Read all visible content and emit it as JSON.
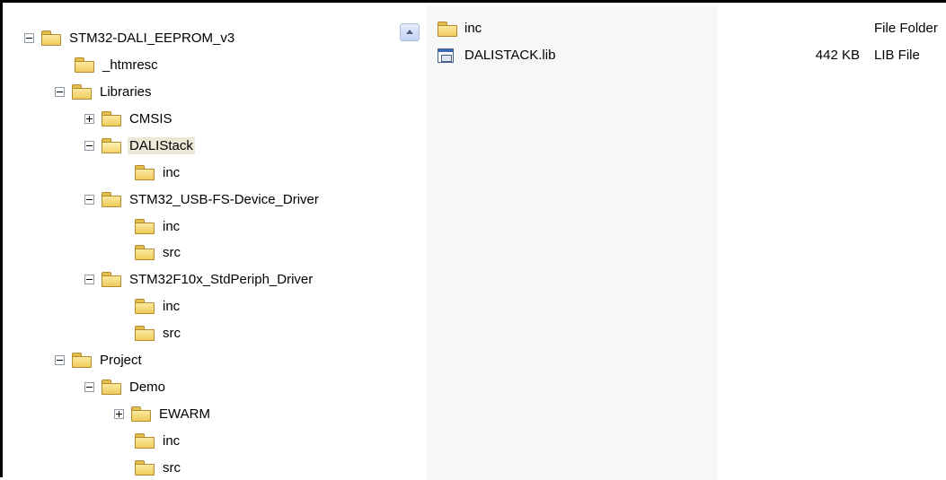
{
  "tree": {
    "nodes": [
      {
        "label": "STM32-DALI_EEPROM_v3",
        "toggle": "minus"
      },
      {
        "label": "_htmresc",
        "toggle": "none"
      },
      {
        "label": "Libraries",
        "toggle": "minus"
      },
      {
        "label": "CMSIS",
        "toggle": "plus"
      },
      {
        "label": "DALIStack",
        "toggle": "minus",
        "selected": true
      },
      {
        "label": "inc",
        "toggle": "none"
      },
      {
        "label": "STM32_USB-FS-Device_Driver",
        "toggle": "minus"
      },
      {
        "label": "inc",
        "toggle": "none"
      },
      {
        "label": "src",
        "toggle": "none"
      },
      {
        "label": "STM32F10x_StdPeriph_Driver",
        "toggle": "minus"
      },
      {
        "label": "inc",
        "toggle": "none"
      },
      {
        "label": "src",
        "toggle": "none"
      },
      {
        "label": "Project",
        "toggle": "minus"
      },
      {
        "label": "Demo",
        "toggle": "minus"
      },
      {
        "label": "EWARM",
        "toggle": "plus"
      },
      {
        "label": "inc",
        "toggle": "none"
      },
      {
        "label": "src",
        "toggle": "none"
      }
    ]
  },
  "files": [
    {
      "icon": "folder-icon",
      "name": "inc",
      "size": "",
      "type": "File Folder"
    },
    {
      "icon": "lib-file-icon",
      "name": "DALISTACK.lib",
      "size": "442 KB",
      "type": "LIB File"
    }
  ]
}
